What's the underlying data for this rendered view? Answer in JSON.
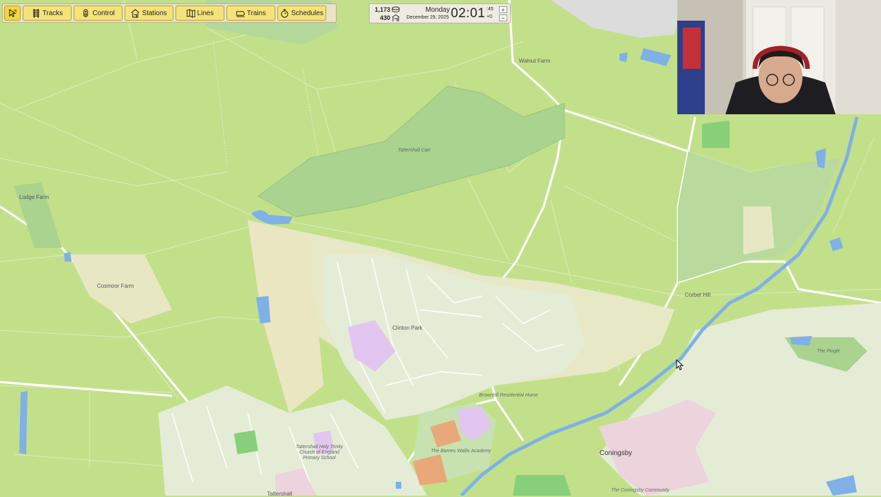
{
  "toolbar": {
    "select_icon": "pointer-select-icon",
    "buttons": [
      {
        "label": "Tracks",
        "icon": "track-icon"
      },
      {
        "label": "Control",
        "icon": "signal-icon"
      },
      {
        "label": "Stations",
        "icon": "station-icon"
      },
      {
        "label": "Lines",
        "icon": "lines-icon"
      },
      {
        "label": "Trains",
        "icon": "train-icon"
      },
      {
        "label": "Schedules",
        "icon": "stopwatch-icon"
      }
    ]
  },
  "status": {
    "money": "1,173",
    "passengers": "430",
    "day": "Monday",
    "date": "December 29, 2025",
    "time": "02:01",
    "seconds": ":45",
    "offset": "+0",
    "speed_up": "+",
    "speed_down": "−"
  },
  "map": {
    "labels": [
      "Walnut Farm",
      "Tattershall Carr",
      "Lodge Farm",
      "Cosmoor Farm",
      "Clinton Park",
      "Corbet Hill",
      "The Pingle",
      "Brownhill Residential Home",
      "Tattershall Holy Trinity Church of England Primary School",
      "The Barnes Wallis Academy",
      "Coningsby",
      "The Coningsby Community",
      "Tattershall"
    ]
  },
  "colors": {
    "farmland": "#c2e08a",
    "residential": "#e4ecd6",
    "woodland": "#a9d38f",
    "water": "#7fb0e6",
    "toolbar_button": "#f6e27a"
  }
}
